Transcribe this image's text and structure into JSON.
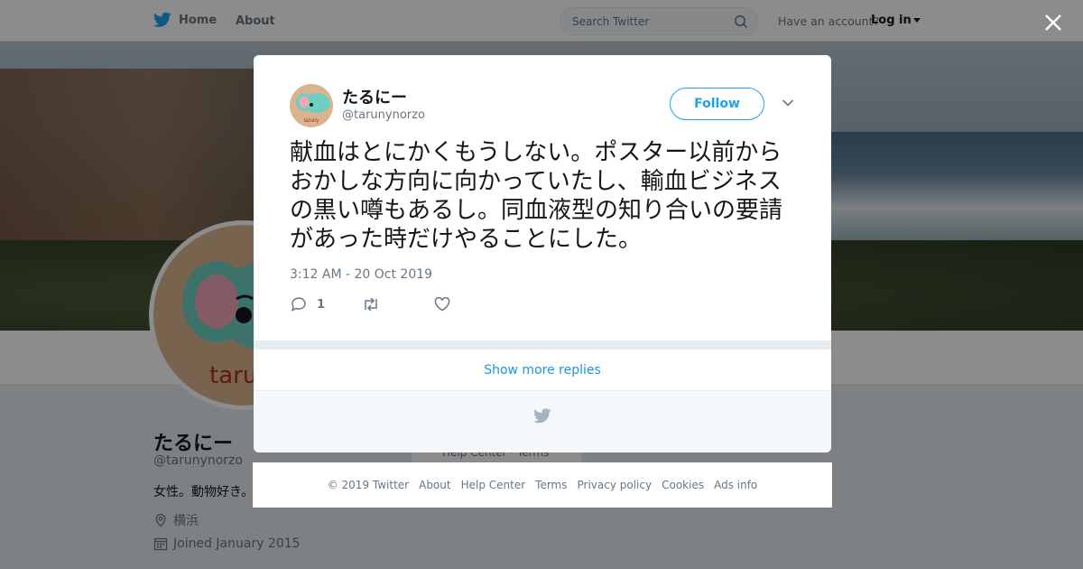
{
  "nav": {
    "home_label": "Home",
    "about_label": "About",
    "search_placeholder": "Search Twitter",
    "have_account": "Have an account?",
    "login_label": "Log in"
  },
  "profile": {
    "name": "たるにー",
    "handle": "@tarunynorzo",
    "bio": "女性。動物好き。",
    "location": "横浜",
    "joined": "Joined January 2015",
    "avatar_text": "taruny"
  },
  "side_card": {
    "text": "Help Center · Terms"
  },
  "tweet": {
    "author_name": "たるにー",
    "author_handle": "@tarunynorzo",
    "avatar_text": "taruny",
    "follow_label": "Follow",
    "text": "献血はとにかくもうしない。ポスター以前からおかしな方向に向かっていたし、輸血ビジネスの黒い噂もあるし。同血液型の知り合いの要請があった時だけやることにした。",
    "timestamp": "3:12 AM - 20 Oct 2019",
    "reply_count": "1"
  },
  "show_more_label": "Show more replies",
  "footer": {
    "links": [
      "© 2019 Twitter",
      "About",
      "Help Center",
      "Terms",
      "Privacy policy",
      "Cookies",
      "Ads info"
    ]
  },
  "colors": {
    "accent": "#1da1f2",
    "text": "#14171a",
    "muted": "#657786"
  }
}
